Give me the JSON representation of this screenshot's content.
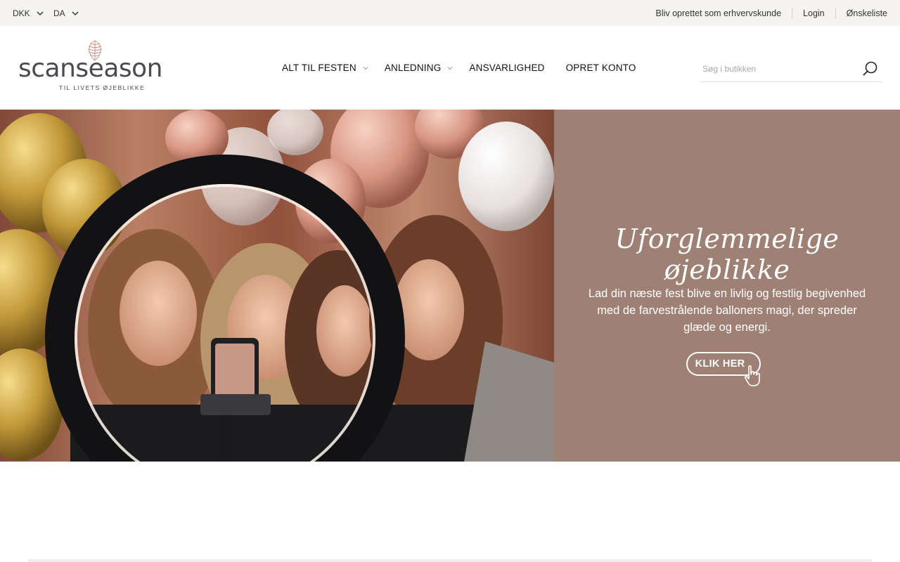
{
  "topbar": {
    "currency": "DKK",
    "language": "DA",
    "links": {
      "business": "Bliv oprettet som erhvervskunde",
      "login": "Login",
      "wishlist": "Ønskeliste"
    }
  },
  "logo": {
    "wordmark": "scanseason",
    "tagline": "TIL LIVETS ØJEBLIKKE"
  },
  "nav": {
    "items": [
      {
        "label": "ALT TIL FESTEN",
        "dropdown": true
      },
      {
        "label": "ANLEDNING",
        "dropdown": true
      },
      {
        "label": "ANSVARLIGHED",
        "dropdown": false
      },
      {
        "label": "OPRET KONTO",
        "dropdown": false
      }
    ]
  },
  "search": {
    "placeholder": "Søg i butikken",
    "value": ""
  },
  "hero": {
    "heading": "Uforglemmelige øjeblikke",
    "body": "Lad din næste fest blive en livlig og festlig begivenhed med de farvestrålende balloners magi, der spreder glæde og energi.",
    "cta": "KLIK HER",
    "panel_color": "#9e8074"
  },
  "colors": {
    "topbar_bg": "#f5f4f0",
    "logo_text": "#4a4a52",
    "logo_mark": "#c98a7c"
  },
  "icons": {
    "currency_chevron": "chevron-down-icon",
    "language_chevron": "chevron-down-icon",
    "search": "search-icon",
    "cta_pointer": "hand-pointer-icon"
  }
}
